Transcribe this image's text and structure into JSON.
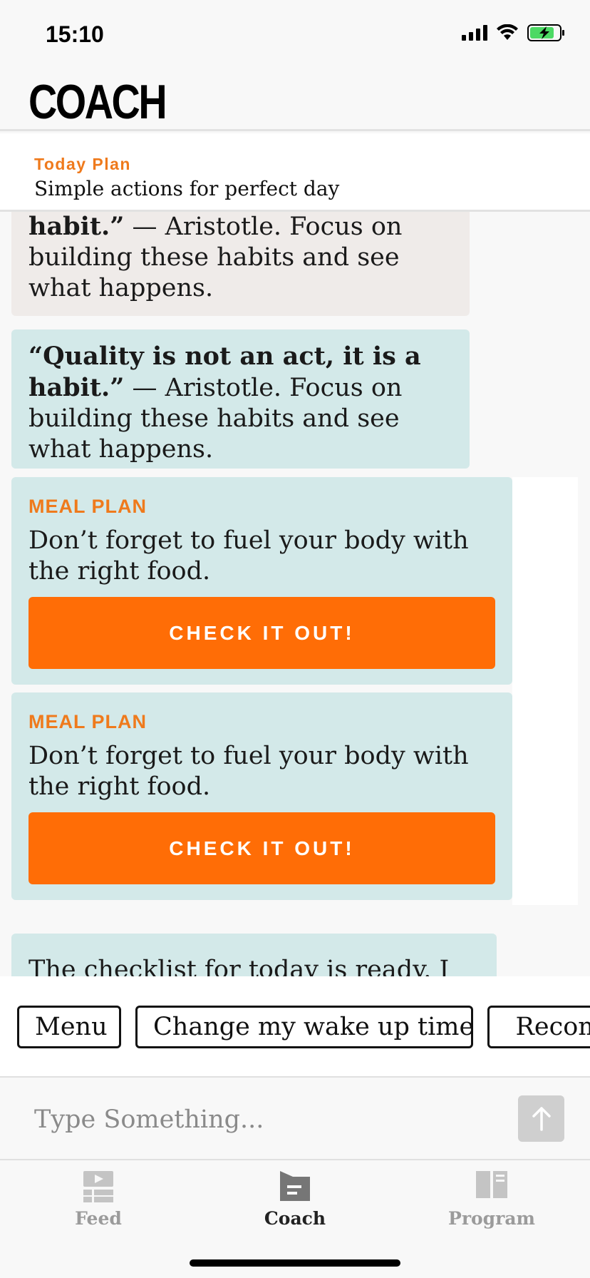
{
  "status_bar": {
    "time": "15:10"
  },
  "header": {
    "title": "COACH"
  },
  "today_plan": {
    "label": "Today Plan",
    "subtitle": "Simple actions for perfect day"
  },
  "messages": {
    "quote_gray": {
      "bold": "habit.”",
      "rest": " — Aristotle. Focus on building these habits and see what happens."
    },
    "quote_teal": {
      "bold": "“Quality is not an act, it is a habit.”",
      "rest": " — Aristotle. Focus on building these habits and see what happens."
    },
    "cards": [
      {
        "label": "MEAL PLAN",
        "text": "Don’t forget to fuel your body with the right food.",
        "button": "CHECK IT OUT!"
      },
      {
        "label": "MEAL PLAN",
        "text": "Don’t forget to fuel your body with the right food.",
        "button": "CHECK IT OUT!"
      }
    ],
    "checklist": "The checklist for today is ready. I"
  },
  "quick_replies": [
    "Menu",
    "Change my wake up time",
    "Recom"
  ],
  "input": {
    "placeholder": "Type Something..."
  },
  "tabs": [
    {
      "label": "Feed",
      "icon": "feed-icon",
      "active": false
    },
    {
      "label": "Coach",
      "icon": "coach-icon",
      "active": true
    },
    {
      "label": "Program",
      "icon": "program-icon",
      "active": false
    }
  ],
  "colors": {
    "accent": "#ff6d06",
    "label_orange": "#ef7a1c",
    "teal_bubble": "#d3e9e9",
    "gray_bubble": "#efebe9"
  }
}
